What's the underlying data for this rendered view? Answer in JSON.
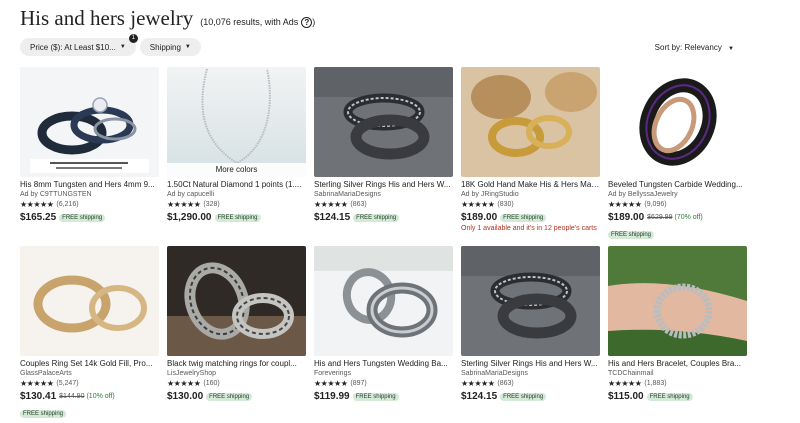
{
  "header": {
    "title": "His and hers jewelry",
    "results": "(10,076 results, with Ads",
    "results_close": ")",
    "help_glyph": "?"
  },
  "filters": [
    {
      "label": "Price ($): At Least $10...",
      "count": "1"
    },
    {
      "label": "Shipping"
    }
  ],
  "caret": "▼",
  "sort": {
    "label": "Sort by: Relevancy"
  },
  "stars": "★★★★★",
  "products": [
    {
      "title": "His 8mm Tungsten and Hers 4mm 9...",
      "shop": "Ad by C9TTUNGSTEN",
      "reviews": "(6,216)",
      "price": "$165.25",
      "shipping": "FREE shipping"
    },
    {
      "title": "1.50Ct Natural Diamond 1 points (1....",
      "shop": "Ad by capucelli",
      "reviews": "(328)",
      "price": "$1,290.00",
      "shipping": "FREE shipping",
      "overlay": "More colors"
    },
    {
      "title": "Sterling Silver Rings His and Hers W...",
      "shop": "SabrinaMariaDesigns",
      "reviews": "(863)",
      "price": "$124.15",
      "shipping": "FREE shipping"
    },
    {
      "title": "18K Gold Hand Make His & Hers Mat...",
      "shop": "Ad by JRingStudio",
      "reviews": "(830)",
      "price": "$189.00",
      "shipping": "FREE shipping",
      "note": "Only 1 available and it's in 12 people's carts"
    },
    {
      "title": "Beveled Tungsten Carbide Wedding...",
      "shop": "Ad by BellyssaJewelry",
      "reviews": "(9,096)",
      "price": "$189.00",
      "original_price": "$629.99",
      "discount": "(70% off)",
      "shipping": "FREE shipping"
    },
    {
      "title": "Couples Ring Set 14k Gold Fill, Pro...",
      "shop": "GlassPalaceArts",
      "reviews": "(5,247)",
      "price": "$130.41",
      "original_price": "$144.90",
      "discount": "(10% off)",
      "shipping": "FREE shipping"
    },
    {
      "title": "Black twig matching rings for coupl...",
      "shop": "LisJewelryShop",
      "reviews": "(160)",
      "price": "$130.00",
      "shipping": "FREE shipping"
    },
    {
      "title": "His and Hers Tungsten Wedding Ba...",
      "shop": "Foreverings",
      "reviews": "(897)",
      "price": "$119.99",
      "shipping": "FREE shipping"
    },
    {
      "title": "Sterling Silver Rings His and Hers W...",
      "shop": "SabrinaMariaDesigns",
      "reviews": "(863)",
      "price": "$124.15",
      "shipping": "FREE shipping"
    },
    {
      "title": "His and Hers Bracelet, Couples Bra...",
      "shop": "TCDChainmail",
      "reviews": "(1,883)",
      "price": "$115.00",
      "shipping": "FREE shipping"
    }
  ],
  "colors": {
    "discount": "#2f7d3a",
    "badge_bg": "#d4e9d7",
    "note": "#b3311f"
  }
}
